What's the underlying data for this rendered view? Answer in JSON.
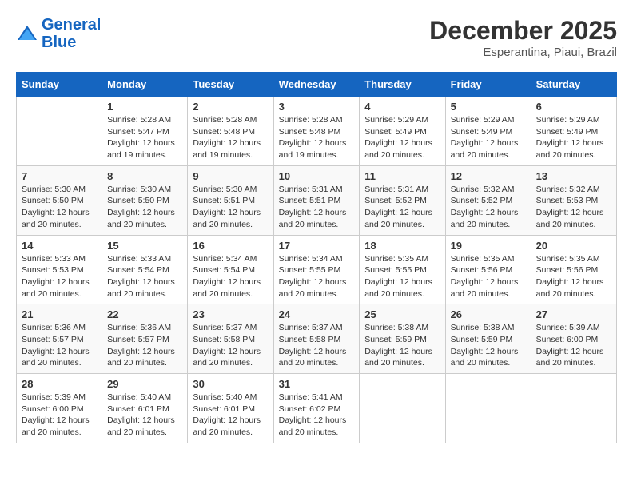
{
  "header": {
    "logo_line1": "General",
    "logo_line2": "Blue",
    "month_title": "December 2025",
    "subtitle": "Esperantina, Piaui, Brazil"
  },
  "days_of_week": [
    "Sunday",
    "Monday",
    "Tuesday",
    "Wednesday",
    "Thursday",
    "Friday",
    "Saturday"
  ],
  "weeks": [
    [
      {
        "num": "",
        "info": ""
      },
      {
        "num": "1",
        "info": "Sunrise: 5:28 AM\nSunset: 5:47 PM\nDaylight: 12 hours\nand 19 minutes."
      },
      {
        "num": "2",
        "info": "Sunrise: 5:28 AM\nSunset: 5:48 PM\nDaylight: 12 hours\nand 19 minutes."
      },
      {
        "num": "3",
        "info": "Sunrise: 5:28 AM\nSunset: 5:48 PM\nDaylight: 12 hours\nand 19 minutes."
      },
      {
        "num": "4",
        "info": "Sunrise: 5:29 AM\nSunset: 5:49 PM\nDaylight: 12 hours\nand 20 minutes."
      },
      {
        "num": "5",
        "info": "Sunrise: 5:29 AM\nSunset: 5:49 PM\nDaylight: 12 hours\nand 20 minutes."
      },
      {
        "num": "6",
        "info": "Sunrise: 5:29 AM\nSunset: 5:49 PM\nDaylight: 12 hours\nand 20 minutes."
      }
    ],
    [
      {
        "num": "7",
        "info": "Sunrise: 5:30 AM\nSunset: 5:50 PM\nDaylight: 12 hours\nand 20 minutes."
      },
      {
        "num": "8",
        "info": "Sunrise: 5:30 AM\nSunset: 5:50 PM\nDaylight: 12 hours\nand 20 minutes."
      },
      {
        "num": "9",
        "info": "Sunrise: 5:30 AM\nSunset: 5:51 PM\nDaylight: 12 hours\nand 20 minutes."
      },
      {
        "num": "10",
        "info": "Sunrise: 5:31 AM\nSunset: 5:51 PM\nDaylight: 12 hours\nand 20 minutes."
      },
      {
        "num": "11",
        "info": "Sunrise: 5:31 AM\nSunset: 5:52 PM\nDaylight: 12 hours\nand 20 minutes."
      },
      {
        "num": "12",
        "info": "Sunrise: 5:32 AM\nSunset: 5:52 PM\nDaylight: 12 hours\nand 20 minutes."
      },
      {
        "num": "13",
        "info": "Sunrise: 5:32 AM\nSunset: 5:53 PM\nDaylight: 12 hours\nand 20 minutes."
      }
    ],
    [
      {
        "num": "14",
        "info": "Sunrise: 5:33 AM\nSunset: 5:53 PM\nDaylight: 12 hours\nand 20 minutes."
      },
      {
        "num": "15",
        "info": "Sunrise: 5:33 AM\nSunset: 5:54 PM\nDaylight: 12 hours\nand 20 minutes."
      },
      {
        "num": "16",
        "info": "Sunrise: 5:34 AM\nSunset: 5:54 PM\nDaylight: 12 hours\nand 20 minutes."
      },
      {
        "num": "17",
        "info": "Sunrise: 5:34 AM\nSunset: 5:55 PM\nDaylight: 12 hours\nand 20 minutes."
      },
      {
        "num": "18",
        "info": "Sunrise: 5:35 AM\nSunset: 5:55 PM\nDaylight: 12 hours\nand 20 minutes."
      },
      {
        "num": "19",
        "info": "Sunrise: 5:35 AM\nSunset: 5:56 PM\nDaylight: 12 hours\nand 20 minutes."
      },
      {
        "num": "20",
        "info": "Sunrise: 5:35 AM\nSunset: 5:56 PM\nDaylight: 12 hours\nand 20 minutes."
      }
    ],
    [
      {
        "num": "21",
        "info": "Sunrise: 5:36 AM\nSunset: 5:57 PM\nDaylight: 12 hours\nand 20 minutes."
      },
      {
        "num": "22",
        "info": "Sunrise: 5:36 AM\nSunset: 5:57 PM\nDaylight: 12 hours\nand 20 minutes."
      },
      {
        "num": "23",
        "info": "Sunrise: 5:37 AM\nSunset: 5:58 PM\nDaylight: 12 hours\nand 20 minutes."
      },
      {
        "num": "24",
        "info": "Sunrise: 5:37 AM\nSunset: 5:58 PM\nDaylight: 12 hours\nand 20 minutes."
      },
      {
        "num": "25",
        "info": "Sunrise: 5:38 AM\nSunset: 5:59 PM\nDaylight: 12 hours\nand 20 minutes."
      },
      {
        "num": "26",
        "info": "Sunrise: 5:38 AM\nSunset: 5:59 PM\nDaylight: 12 hours\nand 20 minutes."
      },
      {
        "num": "27",
        "info": "Sunrise: 5:39 AM\nSunset: 6:00 PM\nDaylight: 12 hours\nand 20 minutes."
      }
    ],
    [
      {
        "num": "28",
        "info": "Sunrise: 5:39 AM\nSunset: 6:00 PM\nDaylight: 12 hours\nand 20 minutes."
      },
      {
        "num": "29",
        "info": "Sunrise: 5:40 AM\nSunset: 6:01 PM\nDaylight: 12 hours\nand 20 minutes."
      },
      {
        "num": "30",
        "info": "Sunrise: 5:40 AM\nSunset: 6:01 PM\nDaylight: 12 hours\nand 20 minutes."
      },
      {
        "num": "31",
        "info": "Sunrise: 5:41 AM\nSunset: 6:02 PM\nDaylight: 12 hours\nand 20 minutes."
      },
      {
        "num": "",
        "info": ""
      },
      {
        "num": "",
        "info": ""
      },
      {
        "num": "",
        "info": ""
      }
    ]
  ]
}
